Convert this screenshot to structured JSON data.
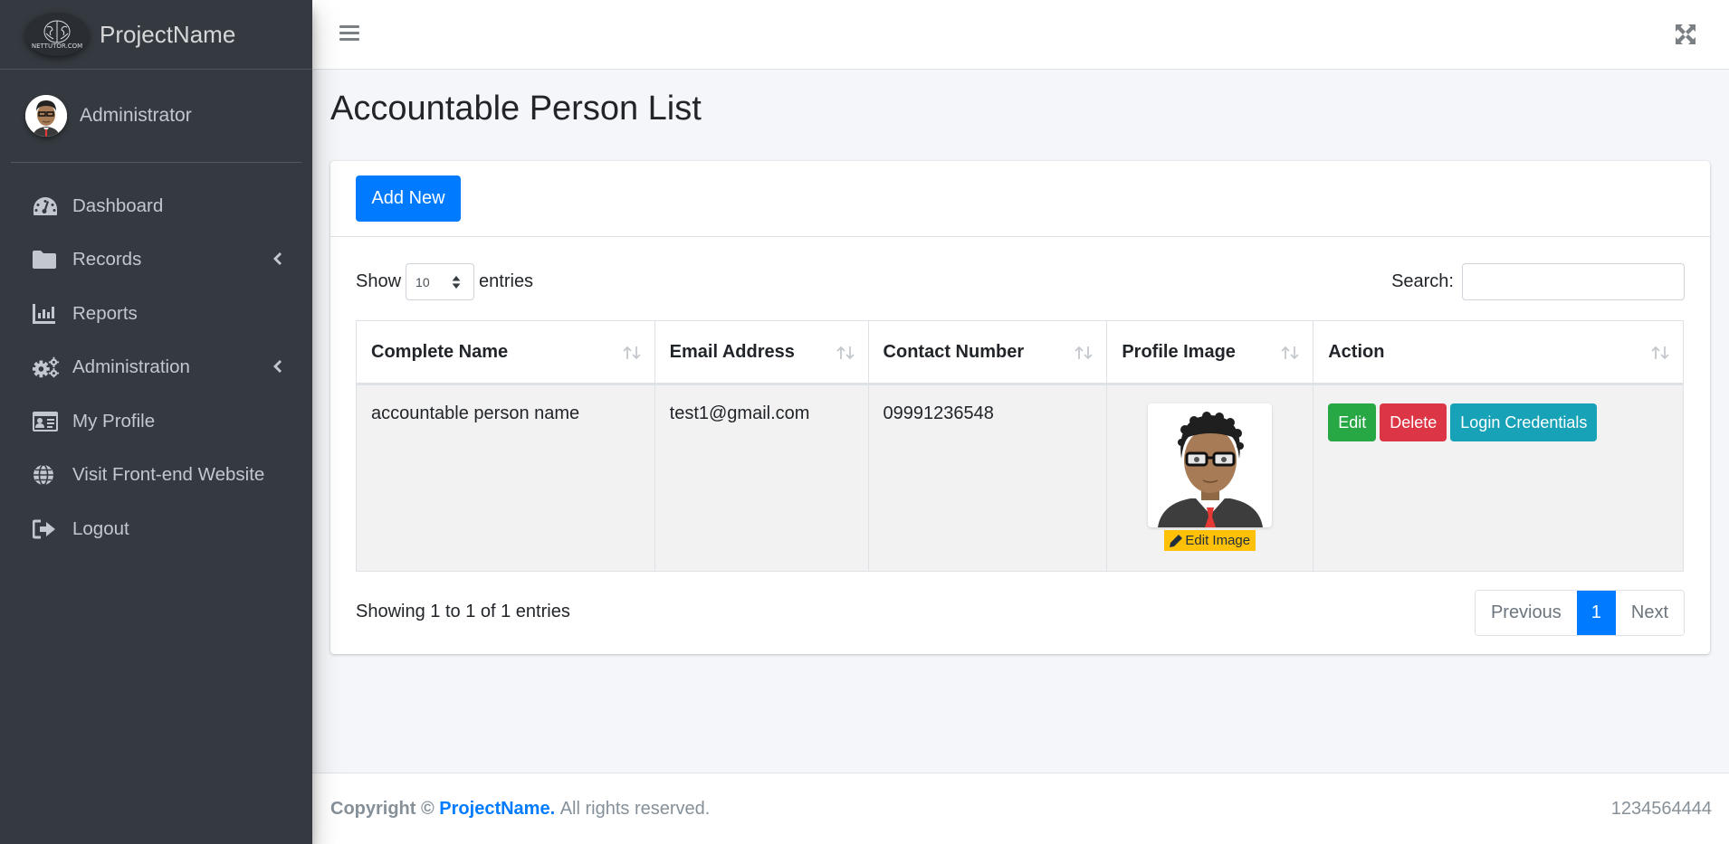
{
  "brand": {
    "name": "ProjectName",
    "logo_text": "NETTUTOR.COM"
  },
  "user": {
    "name": "Administrator"
  },
  "sidebar": {
    "items": [
      {
        "label": "Dashboard",
        "icon": "tachometer-icon",
        "has_submenu": false
      },
      {
        "label": "Records",
        "icon": "folder-icon",
        "has_submenu": true
      },
      {
        "label": "Reports",
        "icon": "chart-bar-icon",
        "has_submenu": false
      },
      {
        "label": "Administration",
        "icon": "cogs-icon",
        "has_submenu": true
      },
      {
        "label": "My Profile",
        "icon": "id-card-icon",
        "has_submenu": false
      },
      {
        "label": "Visit Front-end Website",
        "icon": "globe-icon",
        "has_submenu": false
      },
      {
        "label": "Logout",
        "icon": "sign-out-icon",
        "has_submenu": false
      }
    ]
  },
  "header": {
    "menu_icon": "hamburger-icon",
    "fullscreen_icon": "expand-icon"
  },
  "page": {
    "title": "Accountable Person List"
  },
  "card": {
    "add_button": "Add New",
    "length": {
      "show_label": "Show",
      "value": "10",
      "entries_label": "entries"
    },
    "search": {
      "label": "Search:",
      "value": "",
      "placeholder": ""
    }
  },
  "table": {
    "columns": [
      "Complete Name",
      "Email Address",
      "Contact Number",
      "Profile Image",
      "Action"
    ],
    "rows": [
      {
        "name": "accountable person name",
        "email": "test1@gmail.com",
        "contact": "09991236548",
        "image_button": "Edit Image",
        "actions": [
          "Edit",
          "Delete",
          "Login Credentials"
        ]
      }
    ]
  },
  "info": "Showing 1 to 1 of 1 entries",
  "pagination": {
    "previous": "Previous",
    "current": "1",
    "next": "Next"
  },
  "footer": {
    "copyright": "Copyright ©",
    "brand": "ProjectName.",
    "rights": "All rights reserved.",
    "version": "1234564444"
  },
  "colors": {
    "primary": "#007bff",
    "success": "#28a745",
    "danger": "#dc3545",
    "info": "#17a2b8",
    "warning": "#ffc107",
    "sidebar_bg": "#343a40"
  }
}
